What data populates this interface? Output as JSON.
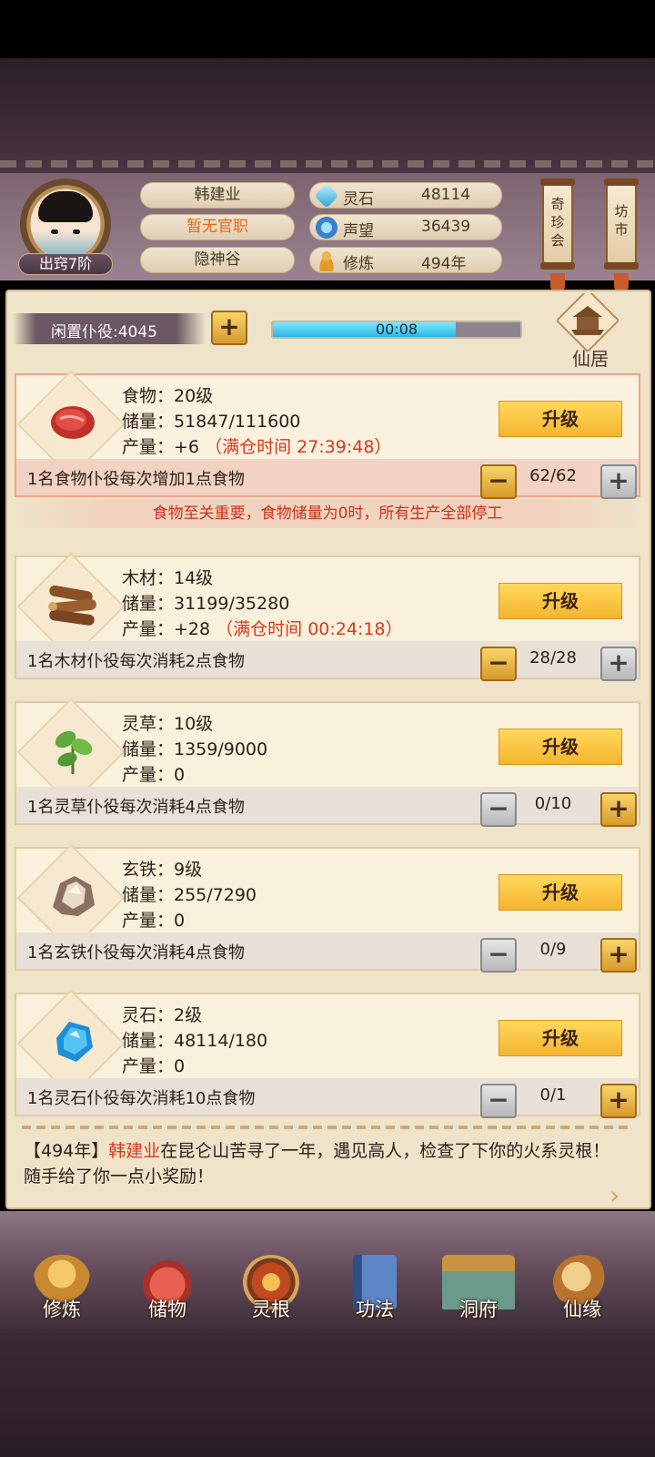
{
  "header": {
    "rank": "出窍7阶",
    "name": "韩建业",
    "title": "暂无官职",
    "location": "隐神谷",
    "stats": [
      {
        "icon": "spirit-stone-icon",
        "label": "灵石",
        "value": "48114"
      },
      {
        "icon": "reputation-icon",
        "label": "声望",
        "value": "36439"
      },
      {
        "icon": "cultivation-icon",
        "label": "修炼",
        "value": "494年"
      }
    ],
    "lanterns": [
      {
        "label": "奇珍会",
        "chars": [
          "奇",
          "珍",
          "会"
        ]
      },
      {
        "label": "坊市",
        "chars": [
          "坊",
          "市"
        ]
      }
    ]
  },
  "idle": {
    "label": "闲置仆役:4045",
    "timer": "00:08",
    "progress": 0.74
  },
  "xianju": {
    "label": "仙居"
  },
  "food_warning": "食物至关重要，食物储量为0时，所有生产全部停工",
  "upgrade_label": "升级",
  "resources": [
    {
      "key": "food",
      "line1": "食物：20级",
      "line2": "储量：51847/111600",
      "line3": "产量：+6",
      "full_time": "（满仓时间 27:39:48）",
      "desc": "1名食物仆役每次增加1点食物",
      "count": "62/62"
    },
    {
      "key": "wood",
      "line1": "木材：14级",
      "line2": "储量：31199/35280",
      "line3": "产量：+28",
      "full_time": "（满仓时间 00:24:18）",
      "desc": "1名木材仆役每次消耗2点食物",
      "count": "28/28"
    },
    {
      "key": "herb",
      "line1": "灵草：10级",
      "line2": "储量：1359/9000",
      "line3": "产量：0",
      "full_time": "",
      "desc": "1名灵草仆役每次消耗4点食物",
      "count": "0/10"
    },
    {
      "key": "iron",
      "line1": "玄铁：9级",
      "line2": "储量：255/7290",
      "line3": "产量：0",
      "full_time": "",
      "desc": "1名玄铁仆役每次消耗4点食物",
      "count": "0/9"
    },
    {
      "key": "stone",
      "line1": "灵石：2级",
      "line2": "储量：48114/180",
      "line3": "产量：0",
      "full_time": "",
      "desc": "1名灵石仆役每次消耗10点食物",
      "count": "0/1"
    }
  ],
  "log": {
    "prefix": "【494年】",
    "who": "韩建业",
    "text": "在昆仑山苦寻了一年，遇见高人，检查了下你的火系灵根！随手给了你一点小奖励！"
  },
  "nav": [
    {
      "label": "修炼",
      "icon": "monk-icon",
      "color": "#d99a3a"
    },
    {
      "label": "储物",
      "icon": "pouch-icon",
      "color": "#d0504a"
    },
    {
      "label": "灵根",
      "icon": "root-icon",
      "color": "#c0662a"
    },
    {
      "label": "功法",
      "icon": "book-icon",
      "color": "#4f78b8"
    },
    {
      "label": "洞府",
      "icon": "cave-icon",
      "color": "#b88a46"
    },
    {
      "label": "仙缘",
      "icon": "gourd-icon",
      "color": "#c48a3e"
    }
  ],
  "colors": {
    "accent_gold": "#f4b52f",
    "warning_red": "#d9381e",
    "progress_cyan": "#2eb6e6"
  }
}
